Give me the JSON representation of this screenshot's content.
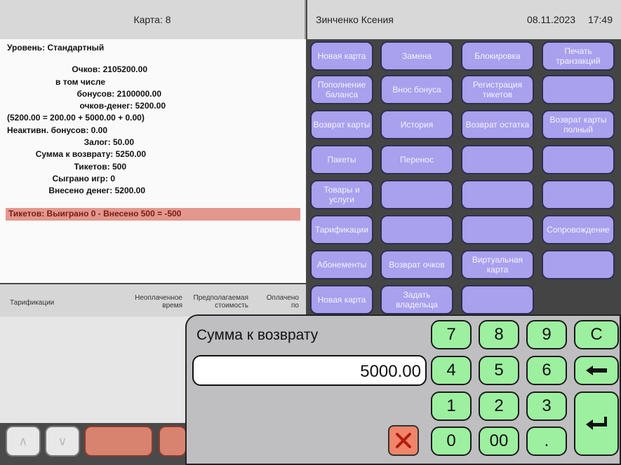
{
  "header": {
    "card": "Карта: 8",
    "user": "Зинченко Ксения",
    "date": "08.11.2023",
    "time": "17:49"
  },
  "info": {
    "level": "Уровень: Стандартный",
    "rows": [
      "Очков: 2105200.00",
      "в том числе",
      "бонусов: 2100000.00",
      "очков-денег: 5200.00",
      "(5200.00 = 200.00 + 5000.00 + 0.00)",
      "Неактивн. бонусов: 0.00",
      "Залог: 50.00",
      "Сумма к возврату: 5250.00",
      "Тикетов: 500",
      "Сыграно игр: 0",
      "Внесено денег: 5200.00"
    ],
    "tickets_line": "Тикетов: Выиграно 0 - Внесено 500 = -500"
  },
  "tarification": {
    "col1": "Тарификации",
    "col2a": "Неоплаченное",
    "col2b": "время",
    "col3a": "Предполагаемая",
    "col3b": "стоимость",
    "col4a": "Оплачено",
    "col4b": "по"
  },
  "actions": {
    "new_card": "Новая карта",
    "replace": "Замена",
    "block": "Блокировка",
    "print_transactions": "Печать транзакций",
    "top_up": "Пополнение баланса",
    "bonus_deposit": "Внос бонуса",
    "ticket_registration": "Регистрация тикетов",
    "return_card": "Возврат карты",
    "history": "История",
    "return_rest": "Возврат остатка",
    "return_card_full": "Возврат карты полный",
    "packages": "Пакеты",
    "transfer": "Перенос",
    "goods_services": "Товары и услуги",
    "tarifications": "Тарификации",
    "escort": "Сопровождение",
    "subscriptions": "Абонементы",
    "return_points": "Возврат очков",
    "virtual_card": "Виртуальная карта",
    "new_card_2": "Новая карта",
    "set_owner": "Задать владельца"
  },
  "dialog": {
    "title": "Сумма к возврату",
    "amount": "5000.00",
    "keys": {
      "k7": "7",
      "k8": "8",
      "k9": "9",
      "clear": "C",
      "k4": "4",
      "k5": "5",
      "k6": "6",
      "k1": "1",
      "k2": "2",
      "k3": "3",
      "k0": "0",
      "k00": "00",
      "dot": "."
    }
  }
}
